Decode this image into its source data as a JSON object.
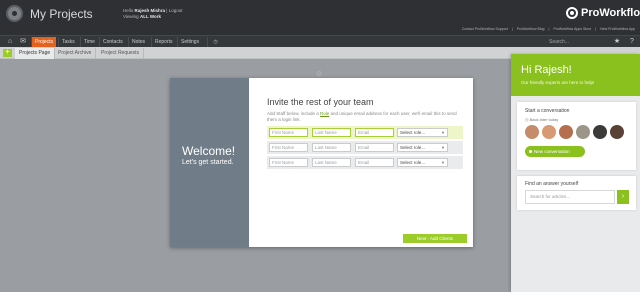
{
  "header": {
    "page_title": "My Projects",
    "hello_prefix": "Hello",
    "user_name": "Rajesh Mishra",
    "logout": "Logout",
    "viewing_prefix": "Viewing",
    "viewing_value": "ALL Work",
    "brand": "ProWorkflow",
    "top_links": [
      "Contact ProWorkflow Support",
      "ProWorkflow Blog",
      "ProWorkflow Apps Store",
      "New ProWorkflow App"
    ]
  },
  "nav": {
    "tabs": [
      "Projects",
      "Tasks",
      "Time",
      "Contacts",
      "Notes",
      "Reports",
      "Settings"
    ],
    "active_tab": "Projects",
    "search_placeholder": "Search..."
  },
  "subnav": {
    "add_label": "+",
    "tabs": [
      "Projects Page",
      "Project Archive",
      "Project Requests"
    ]
  },
  "modal": {
    "welcome": "Welcome!",
    "started": "Let's get started.",
    "title": "Invite the rest of your team",
    "desc_before": "Add Staff below, include a ",
    "desc_link": "Role",
    "desc_after": " and unique email address for each user, we'll email this to send them a login link.",
    "rows": [
      {
        "first": "First Name",
        "last": "Last Name",
        "email": "Email",
        "role": "Select role..."
      },
      {
        "first": "First Name",
        "last": "Last Name",
        "email": "Email",
        "role": "Select role..."
      },
      {
        "first": "First Name",
        "last": "Last Name",
        "email": "Email",
        "role": "Select role..."
      }
    ],
    "next_button": "Next - Add Clients"
  },
  "help_panel": {
    "greeting": "Hi Rajesh!",
    "subtitle": "Our friendly experts are here to help!",
    "start_title": "Start a conversation",
    "back_link": "Back later today",
    "new_conversation": "New conversation",
    "answer_title": "Find an answer yourself",
    "search_placeholder": "Search for articles..."
  },
  "colors": {
    "accent_green": "#8bc11f",
    "active_tab_orange": "#e3621f",
    "modal_sidebar": "#707d88",
    "header_dark": "#2e3033"
  }
}
